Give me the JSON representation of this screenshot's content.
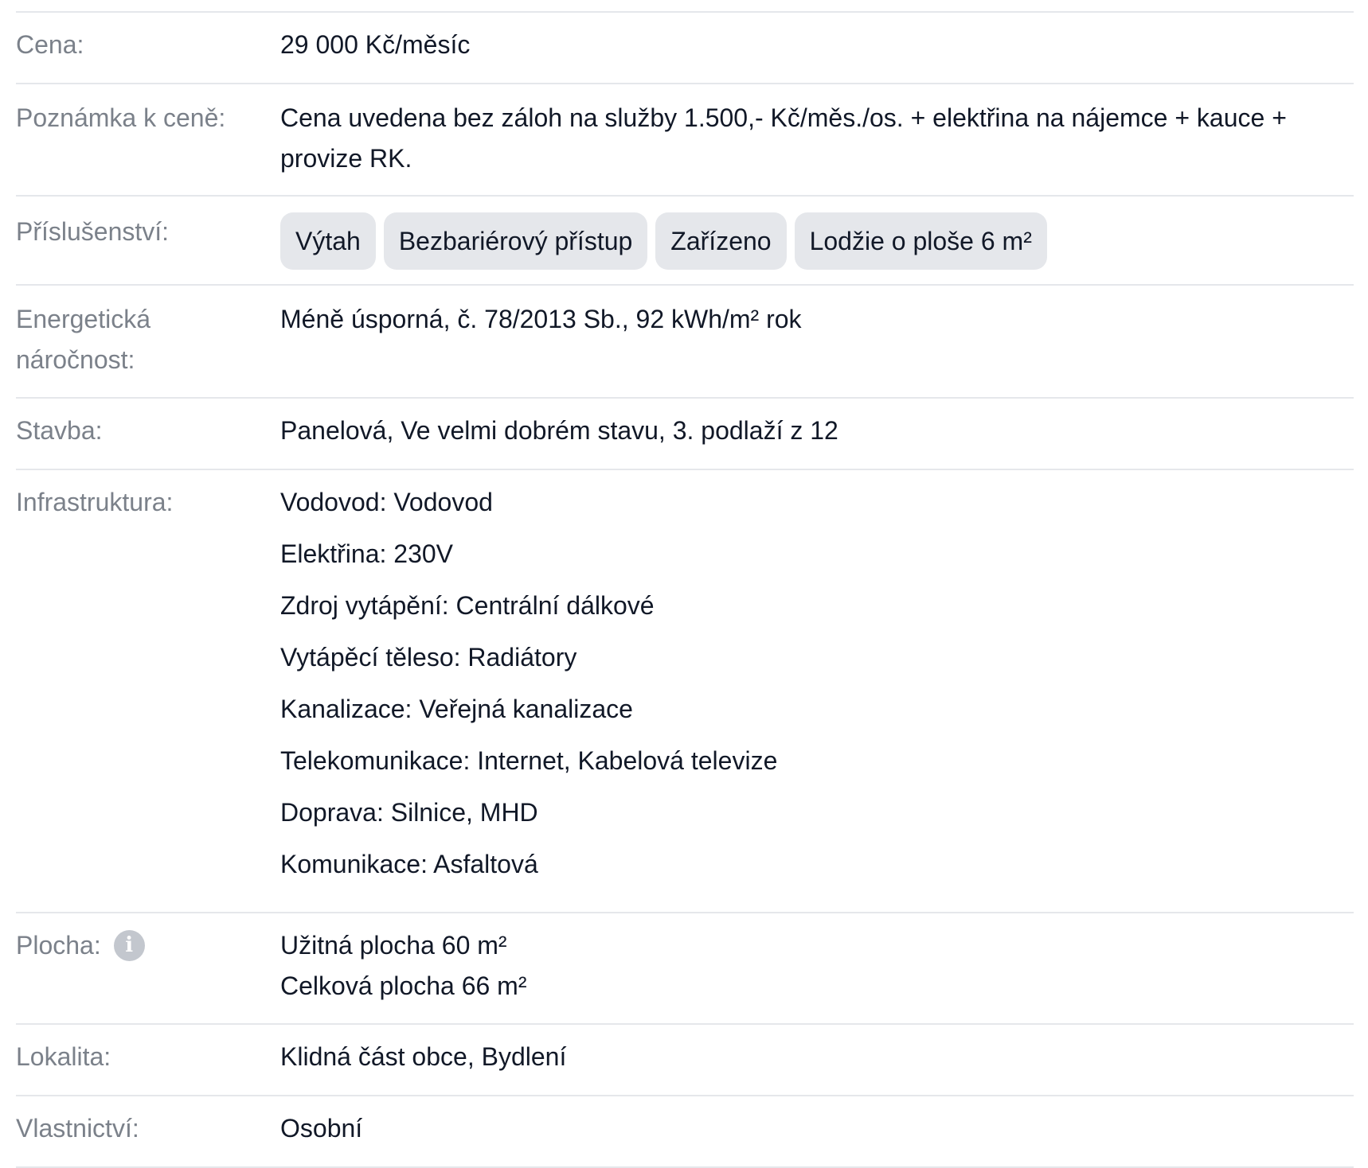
{
  "rows": {
    "cena": {
      "label": "Cena:",
      "value": "29 000 Kč/měsíc"
    },
    "poznamka": {
      "label": "Poznámka k ceně:",
      "value": "Cena uvedena bez záloh na služby 1.500,- Kč/měs./os. + elektřina na nájemce + kauce + provize RK."
    },
    "prislusenstvi": {
      "label": "Příslušenství:",
      "tags": [
        "Výtah",
        "Bezbariérový přístup",
        "Zařízeno",
        "Lodžie o ploše 6 m²"
      ]
    },
    "energeticka": {
      "label": "Energetická náročnost:",
      "value": "Méně úsporná, č. 78/2013 Sb., 92 kWh/m² rok"
    },
    "stavba": {
      "label": "Stavba:",
      "value": "Panelová, Ve velmi dobrém stavu, 3. podlaží z 12"
    },
    "infrastruktura": {
      "label": "Infrastruktura:",
      "items": [
        "Vodovod: Vodovod",
        "Elektřina: 230V",
        "Zdroj vytápění: Centrální dálkové",
        "Vytápěcí těleso: Radiátory",
        "Kanalizace: Veřejná kanalizace",
        "Telekomunikace: Internet, Kabelová televize",
        "Doprava: Silnice, MHD",
        "Komunikace: Asfaltová"
      ]
    },
    "plocha": {
      "label": "Plocha:",
      "icon": "info-icon",
      "icon_glyph": "i",
      "lines": [
        "Užitná plocha 60 m²",
        "Celková plocha 66 m²"
      ]
    },
    "lokalita": {
      "label": "Lokalita:",
      "value": "Klidná část obce, Bydlení"
    },
    "vlastnictvi": {
      "label": "Vlastnictví:",
      "value": "Osobní"
    }
  },
  "colors": {
    "label": "#7b818a",
    "value": "#111827",
    "divider": "#e5e7eb",
    "tag_bg": "#e5e7eb",
    "info_icon_bg": "#c3c7ce"
  }
}
